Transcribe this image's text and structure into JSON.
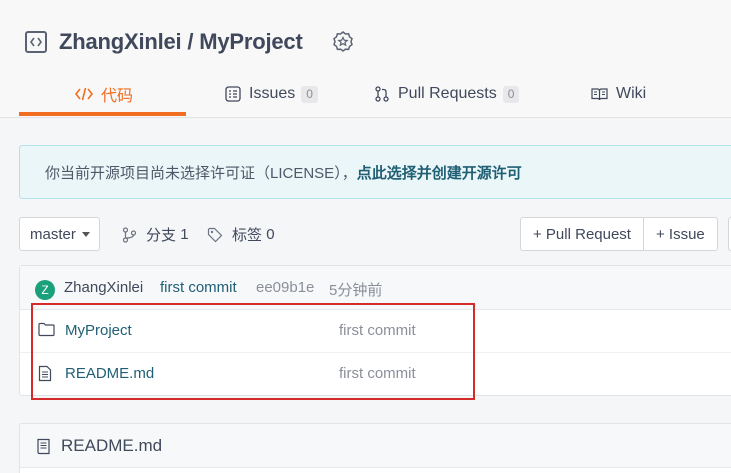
{
  "header": {
    "owner": "ZhangXinlei",
    "separator": " / ",
    "repo": "MyProject",
    "repo_icon": "code-box-icon",
    "badge_icon": "award-badge-icon"
  },
  "tabs": [
    {
      "label": "代码",
      "icon": "code-icon",
      "active": true
    },
    {
      "label": "Issues",
      "count": "0",
      "icon": "issues-icon"
    },
    {
      "label": "Pull Requests",
      "count": "0",
      "icon": "pull-request-icon"
    },
    {
      "label": "Wiki",
      "icon": "book-icon"
    }
  ],
  "notice": {
    "text": "你当前开源项目尚未选择许可证（LICENSE），",
    "link": "点此选择并创建开源许可"
  },
  "toolbar": {
    "branch": "master",
    "branches_label": "分支",
    "branches_count": "1",
    "tags_label": "标签",
    "tags_count": "0",
    "pull_request_button": "+ Pull Request",
    "issue_button": "+ Issue"
  },
  "commit": {
    "avatar_letter": "Z",
    "author": "ZhangXinlei",
    "message": "first commit",
    "sha": "ee09b1e",
    "time": "5分钟前"
  },
  "files": [
    {
      "name": "MyProject",
      "type": "folder",
      "icon": "folder-icon",
      "message": "first commit"
    },
    {
      "name": "README.md",
      "type": "file",
      "icon": "file-icon",
      "message": "first commit"
    }
  ],
  "readme": {
    "title": "README.md",
    "icon": "book-icon"
  },
  "colors": {
    "accent": "#f06d21",
    "link": "#1f5f74",
    "highlight": "#d42a2a",
    "avatar": "#1aa07a"
  }
}
